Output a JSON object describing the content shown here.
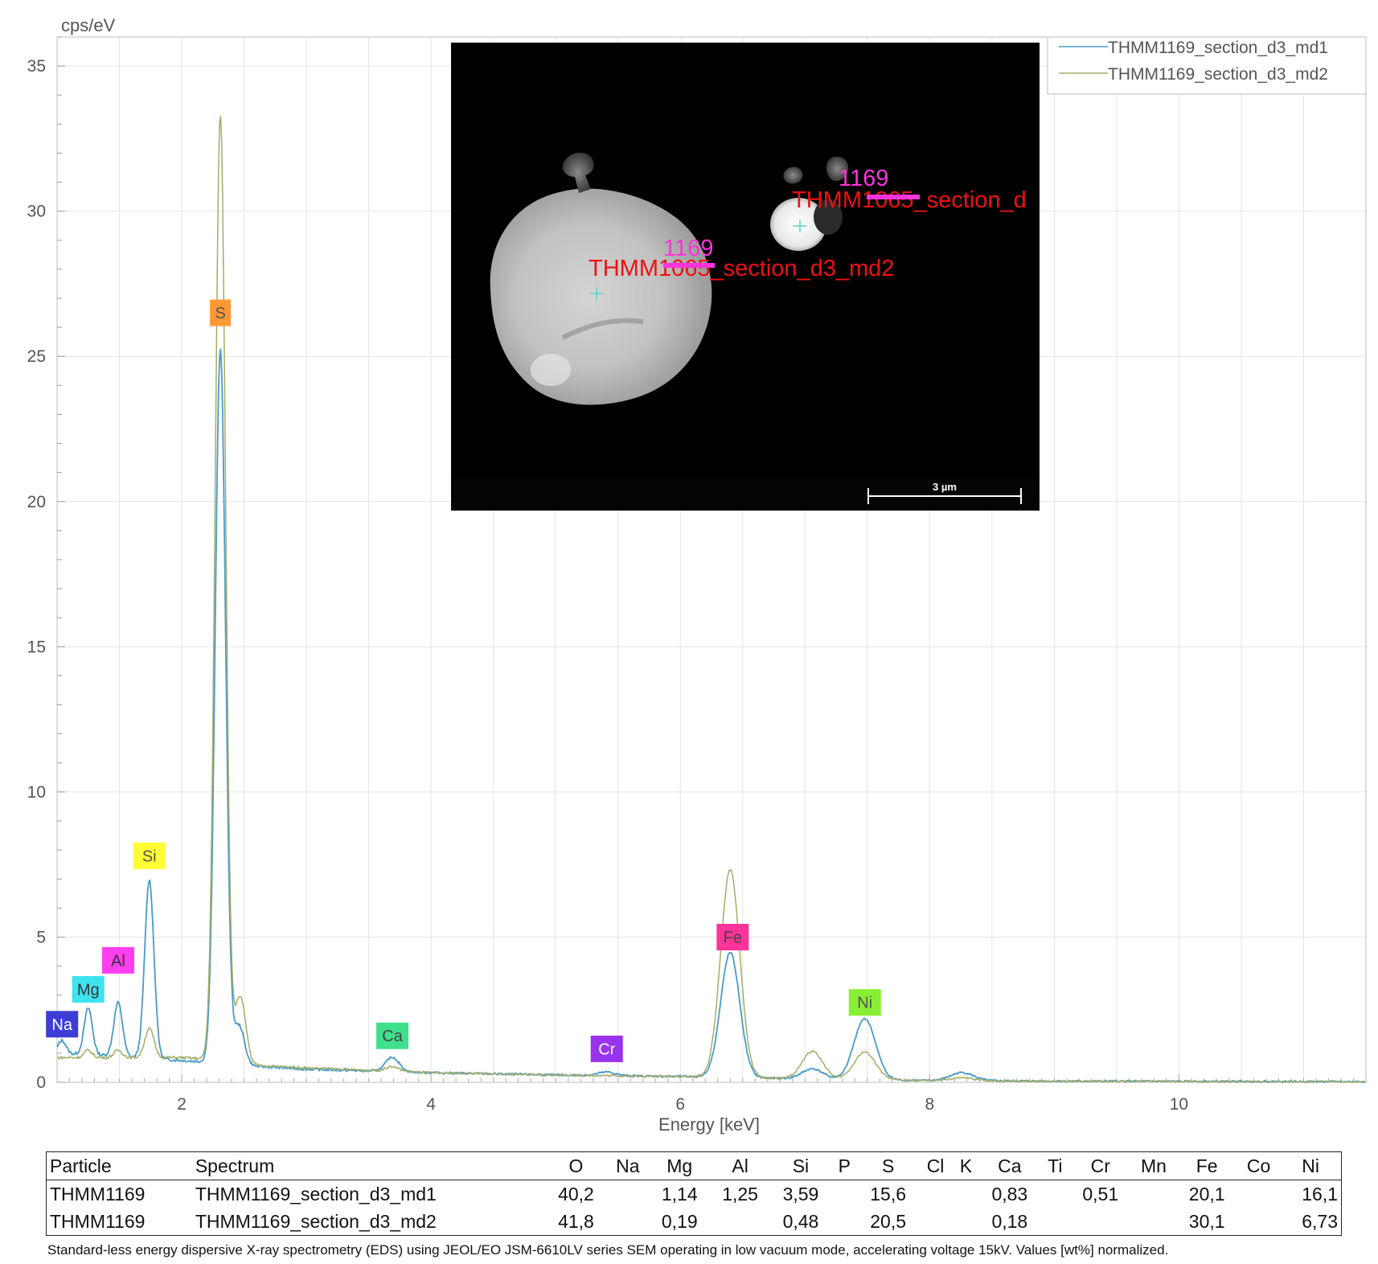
{
  "chart_data": {
    "type": "line",
    "ylabel": "cps/eV",
    "xlabel": "Energy [keV]",
    "xlim": [
      1.0,
      11.5
    ],
    "ylim": [
      0,
      36
    ],
    "xticks": [
      2,
      4,
      6,
      8,
      10
    ],
    "yticks": [
      0,
      5,
      10,
      15,
      20,
      25,
      30,
      35
    ],
    "grid": true,
    "legend_position": "top-right",
    "series": [
      {
        "name": "THMM1169_section_d3_md1",
        "color": "#4a9ac8",
        "baseline": [
          [
            1.0,
            1.0
          ],
          [
            1.3,
            0.95
          ],
          [
            2.0,
            0.75
          ],
          [
            2.2,
            0.7
          ],
          [
            2.6,
            0.55
          ],
          [
            3.0,
            0.45
          ],
          [
            4.0,
            0.33
          ],
          [
            5.0,
            0.25
          ],
          [
            6.0,
            0.2
          ],
          [
            7.0,
            0.12
          ],
          [
            8.0,
            0.06
          ],
          [
            9.0,
            0.04
          ],
          [
            11.5,
            0.02
          ]
        ],
        "peaks": [
          {
            "element": "Na",
            "energy": 1.04,
            "height": 0.45
          },
          {
            "element": "Mg",
            "energy": 1.25,
            "height": 1.6
          },
          {
            "element": "Al",
            "energy": 1.49,
            "height": 1.85
          },
          {
            "element": "Si",
            "energy": 1.74,
            "height": 6.15
          },
          {
            "element": "S",
            "energy": 2.31,
            "height": 24.6
          },
          {
            "element": "S",
            "energy": 2.46,
            "height": 1.35
          },
          {
            "element": "Ca",
            "energy": 3.69,
            "height": 0.5
          },
          {
            "element": "Cr",
            "energy": 5.41,
            "height": 0.12
          },
          {
            "element": "Fe",
            "energy": 6.4,
            "height": 4.3
          },
          {
            "element": "Fe",
            "energy": 7.06,
            "height": 0.35
          },
          {
            "element": "Ni",
            "energy": 7.48,
            "height": 2.1
          },
          {
            "element": "Ni",
            "energy": 8.26,
            "height": 0.28
          }
        ]
      },
      {
        "name": "THMM1169_section_d3_md2",
        "color": "#a3ad6a",
        "baseline": [
          [
            1.0,
            0.85
          ],
          [
            1.3,
            0.85
          ],
          [
            2.0,
            0.85
          ],
          [
            2.2,
            0.8
          ],
          [
            2.6,
            0.58
          ],
          [
            3.0,
            0.5
          ],
          [
            4.0,
            0.33
          ],
          [
            5.0,
            0.25
          ],
          [
            6.0,
            0.2
          ],
          [
            7.0,
            0.12
          ],
          [
            8.0,
            0.06
          ],
          [
            9.0,
            0.04
          ],
          [
            11.5,
            0.02
          ]
        ],
        "peaks": [
          {
            "element": "Mg",
            "energy": 1.25,
            "height": 0.25
          },
          {
            "element": "Al",
            "energy": 1.49,
            "height": 0.25
          },
          {
            "element": "Si",
            "energy": 1.74,
            "height": 1.0
          },
          {
            "element": "S",
            "energy": 2.31,
            "height": 32.6
          },
          {
            "element": "S",
            "energy": 2.47,
            "height": 2.3
          },
          {
            "element": "Ca",
            "energy": 3.69,
            "height": 0.15
          },
          {
            "element": "Fe",
            "energy": 6.4,
            "height": 7.15
          },
          {
            "element": "Fe",
            "energy": 7.06,
            "height": 0.95
          },
          {
            "element": "Ni",
            "energy": 7.48,
            "height": 0.95
          },
          {
            "element": "Ni",
            "energy": 8.26,
            "height": 0.1
          }
        ]
      }
    ],
    "element_markers": [
      {
        "label": "Na",
        "energy": 1.04,
        "level": 2.0,
        "bg": "#3d3dd6",
        "fg": "#ffffff"
      },
      {
        "label": "Mg",
        "energy": 1.25,
        "level": 3.2,
        "bg": "#3de4f0",
        "fg": "#333333"
      },
      {
        "label": "Al",
        "energy": 1.49,
        "level": 4.2,
        "bg": "#ff3ef0",
        "fg": "#333333"
      },
      {
        "label": "Si",
        "energy": 1.74,
        "level": 7.8,
        "bg": "#ffff33",
        "fg": "#555555"
      },
      {
        "label": "S",
        "energy": 2.31,
        "level": 26.5,
        "bg": "#ff9933",
        "fg": "#555555"
      },
      {
        "label": "Ca",
        "energy": 3.69,
        "level": 1.6,
        "bg": "#3ee08c",
        "fg": "#444444"
      },
      {
        "label": "Cr",
        "energy": 5.41,
        "level": 1.15,
        "bg": "#9933ee",
        "fg": "#ffffff"
      },
      {
        "label": "Fe",
        "energy": 6.42,
        "level": 5.0,
        "bg": "#ff3399",
        "fg": "#444444"
      },
      {
        "label": "Ni",
        "energy": 7.48,
        "level": 2.75,
        "bg": "#88ee33",
        "fg": "#555555"
      }
    ]
  },
  "inset": {
    "scale_bar": "3 µm",
    "label1_id": "1169",
    "label1_text": "THMM1065_section_d",
    "label2_id": "1169",
    "label2_text": "THMM1065_section_d3_md2"
  },
  "table": {
    "headers": [
      "Particle",
      "Spectrum",
      "O",
      "Na",
      "Mg",
      "Al",
      "Si",
      "P",
      "S",
      "Cl",
      "K",
      "Ca",
      "Ti",
      "Cr",
      "Mn",
      "Fe",
      "Co",
      "Ni"
    ],
    "rows": [
      [
        "THMM1169",
        "THMM1169_section_d3_md1",
        "40,2",
        "",
        "1,14",
        "1,25",
        "3,59",
        "",
        "15,6",
        "",
        "",
        "0,83",
        "",
        "0,51",
        "",
        "20,1",
        "",
        "16,1"
      ],
      [
        "THMM1169",
        "THMM1169_section_d3_md2",
        "41,8",
        "",
        "0,19",
        "",
        "0,48",
        "",
        "20,5",
        "",
        "",
        "0,18",
        "",
        "",
        "",
        "30,1",
        "",
        "6,73"
      ]
    ]
  },
  "footnote": "Standard-less energy dispersive X-ray spectrometry (EDS) using JEOL/EO JSM-6610LV series SEM operating in low vacuum mode, accelerating voltage 15kV. Values [wt%] normalized."
}
